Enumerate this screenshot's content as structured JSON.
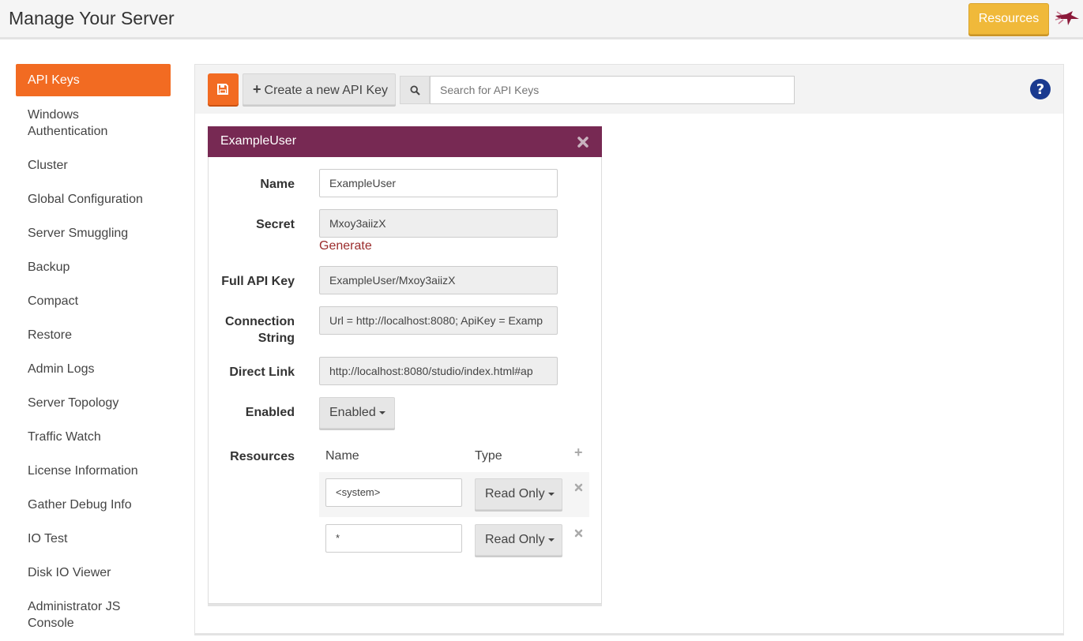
{
  "header": {
    "title": "Manage Your Server",
    "resources_label": "Resources"
  },
  "sidebar": {
    "items": [
      {
        "label": "API Keys",
        "active": true
      },
      {
        "label": "Windows Authentication"
      },
      {
        "label": "Cluster"
      },
      {
        "label": "Global Configuration"
      },
      {
        "label": "Server Smuggling"
      },
      {
        "label": "Backup"
      },
      {
        "label": "Compact"
      },
      {
        "label": "Restore"
      },
      {
        "label": "Admin Logs"
      },
      {
        "label": "Server Topology"
      },
      {
        "label": "Traffic Watch"
      },
      {
        "label": "License Information"
      },
      {
        "label": "Gather Debug Info"
      },
      {
        "label": "IO Test"
      },
      {
        "label": "Disk IO Viewer"
      },
      {
        "label": "Administrator JS Console"
      }
    ]
  },
  "toolbar": {
    "create_label": "Create a new API Key",
    "search_placeholder": "Search for API Keys"
  },
  "api_key": {
    "header_name": "ExampleUser",
    "labels": {
      "name": "Name",
      "secret": "Secret",
      "full_key": "Full API Key",
      "connection_string": "Connection String",
      "direct_link": "Direct Link",
      "enabled": "Enabled",
      "resources": "Resources"
    },
    "name": "ExampleUser",
    "secret": "Mxoy3aiizX",
    "generate_label": "Generate",
    "full_key": "ExampleUser/Mxoy3aiizX",
    "connection_string": "Url = http://localhost:8080; ApiKey = Examp",
    "direct_link": "http://localhost:8080/studio/index.html#ap",
    "enabled_value": "Enabled",
    "resources_columns": {
      "name": "Name",
      "type": "Type"
    },
    "resources": [
      {
        "name": "<system>",
        "type": "Read Only"
      },
      {
        "name": "*",
        "type": "Read Only"
      }
    ]
  },
  "colors": {
    "accent": "#f26b22",
    "card_header": "#772953",
    "resources_button": "#f0b93a",
    "help_icon": "#1a3a8f"
  }
}
